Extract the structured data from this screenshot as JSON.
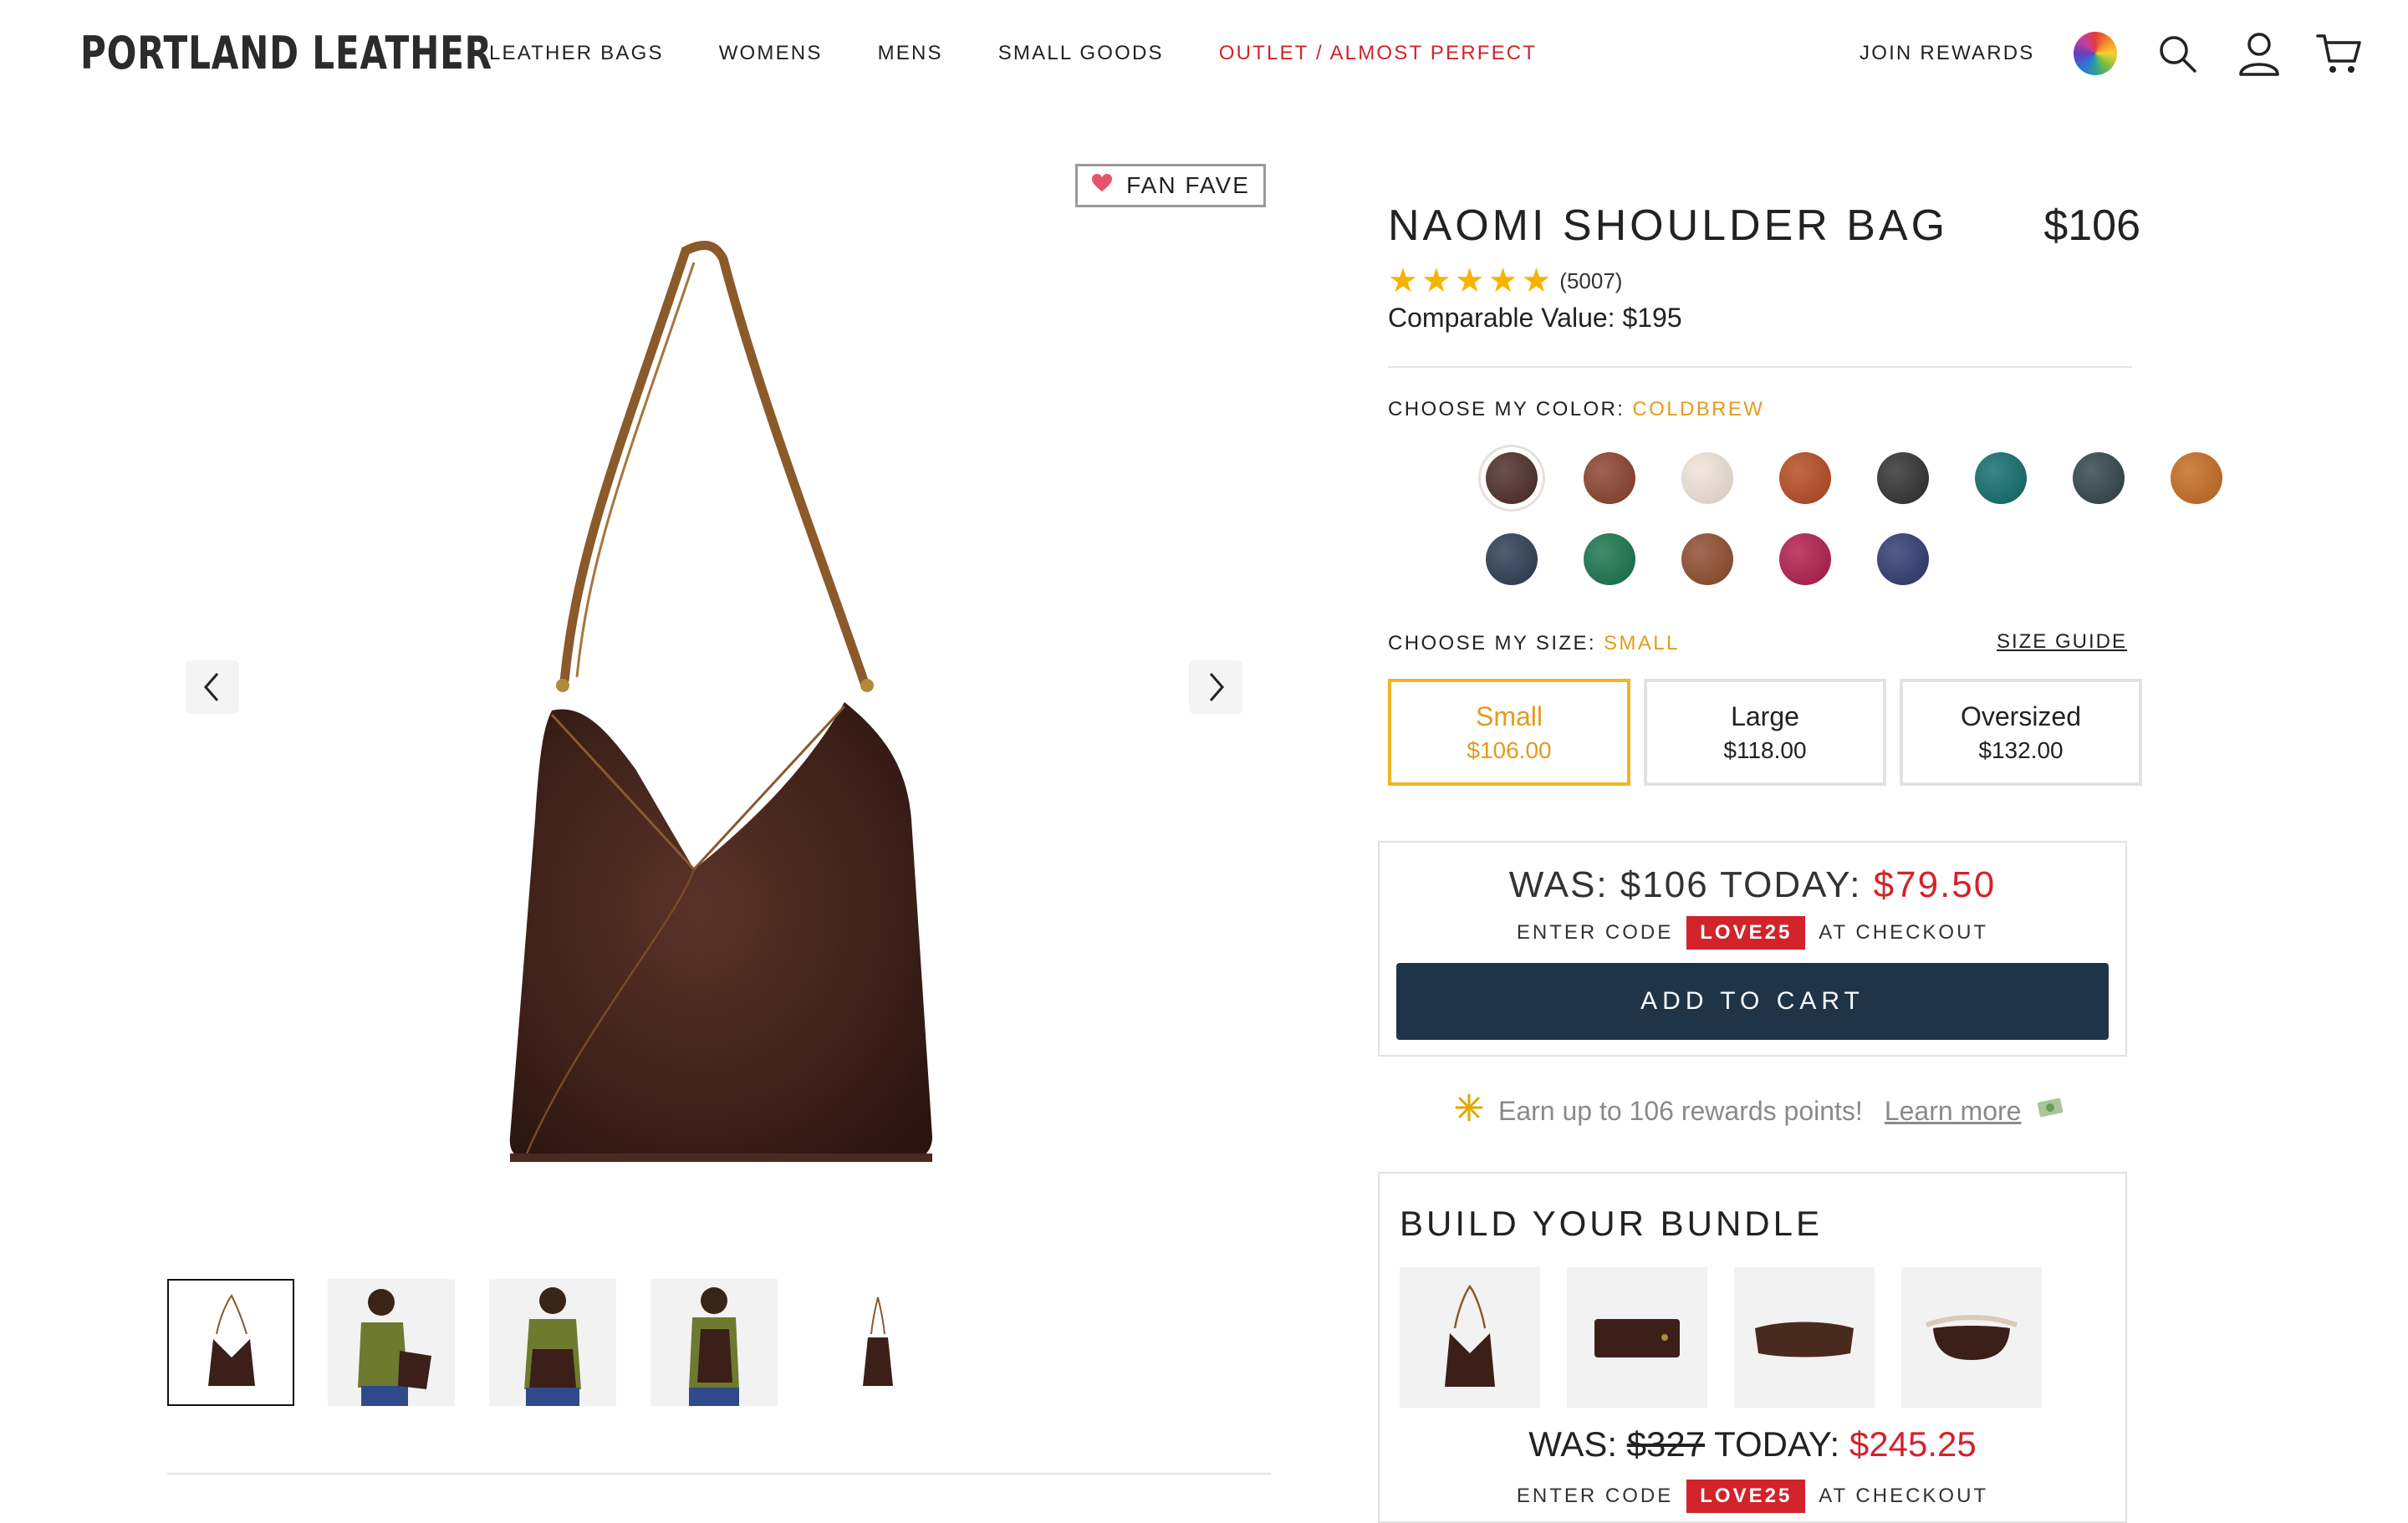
{
  "header": {
    "logo": "PORTLAND LEATHER",
    "nav": [
      "LEATHER BAGS",
      "WOMENS",
      "MENS",
      "SMALL GOODS",
      "OUTLET / ALMOST PERFECT"
    ],
    "join_rewards": "JOIN REWARDS",
    "icons": [
      "color-wheel-icon",
      "search-icon",
      "account-icon",
      "cart-icon"
    ],
    "outlet_color": "#d2232a"
  },
  "gallery": {
    "badge": "FAN FAVE",
    "badge_icon": "heart-icon",
    "thumbnails": [
      {
        "name": "bag-front"
      },
      {
        "name": "model-shoulder-side"
      },
      {
        "name": "model-front-hold"
      },
      {
        "name": "model-back"
      },
      {
        "name": "bag-side"
      }
    ],
    "selected_thumbnail": 0
  },
  "product": {
    "title": "NAOMI SHOULDER BAG",
    "price": "$106",
    "rating": 5,
    "review_count": "(5007)",
    "comparable_value": "Comparable Value: $195"
  },
  "color_picker": {
    "label": "CHOOSE MY COLOR:",
    "selected": "COLDBREW",
    "swatches": [
      "#4a2a24",
      "#8a3f2c",
      "#efe3d6",
      "#b5471f",
      "#2e2e2e",
      "#0f6a6a",
      "#2f4248",
      "#c46a1f",
      "#2b3a52",
      "#17724a",
      "#8c4a2c",
      "#b01a4a",
      "#2d3870"
    ],
    "selected_index": 0
  },
  "size_picker": {
    "label": "CHOOSE MY SIZE:",
    "selected": "SMALL",
    "size_guide": "SIZE GUIDE",
    "options": [
      {
        "name": "Small",
        "price": "$106.00"
      },
      {
        "name": "Large",
        "price": "$118.00"
      },
      {
        "name": "Oversized",
        "price": "$132.00"
      }
    ],
    "selected_index": 0
  },
  "promo": {
    "was_label": "WAS: $106 TODAY:",
    "today_price": "$79.50",
    "enter_code": "ENTER CODE",
    "code": "LOVE25",
    "at_checkout": "AT CHECKOUT",
    "add_to_cart": "ADD TO CART"
  },
  "rewards": {
    "text": "Earn up to 106 rewards points!",
    "learn_more": "Learn more",
    "icon": "sparkle-icon",
    "money_icon": "money-icon"
  },
  "bundle": {
    "title": "BUILD YOUR BUNDLE",
    "items": [
      "shoulder-bag",
      "wallet",
      "pouch",
      "sling-bag"
    ],
    "was_label": "WAS:",
    "was_price": "$327",
    "today_label": "TODAY:",
    "today_price": "$245.25",
    "enter_code": "ENTER CODE",
    "code": "LOVE25",
    "at_checkout": "AT CHECKOUT"
  },
  "colors": {
    "accent": "#e49b1c",
    "sale_red": "#d2232a",
    "cart_button": "#1f3447",
    "star": "#f5b400"
  }
}
